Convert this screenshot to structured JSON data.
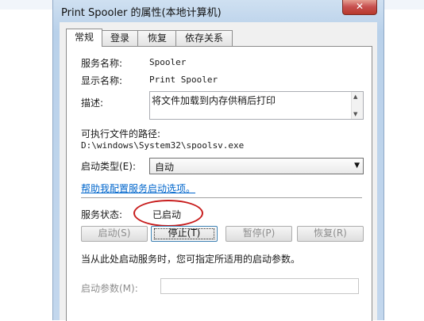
{
  "window": {
    "title": "Print Spooler 的属性(本地计算机)",
    "close_glyph": "✕"
  },
  "tabs": [
    {
      "label": "常规"
    },
    {
      "label": "登录"
    },
    {
      "label": "恢复"
    },
    {
      "label": "依存关系"
    }
  ],
  "general": {
    "service_name_label": "服务名称:",
    "service_name_value": "Spooler",
    "display_name_label": "显示名称:",
    "display_name_value": "Print Spooler",
    "description_label": "描述:",
    "description_value": "将文件加载到内存供稍后打印",
    "exe_path_label": "可执行文件的路径:",
    "exe_path_value": "D:\\windows\\System32\\spoolsv.exe",
    "startup_type_label": "启动类型(E):",
    "startup_type_value": "自动",
    "help_link": "帮助我配置服务启动选项。",
    "status_label": "服务状态:",
    "status_value": "已启动",
    "buttons": {
      "start": "启动(S)",
      "stop": "停止(T)",
      "pause": "暂停(P)",
      "resume": "恢复(R)"
    },
    "hint": "当从此处启动服务时，您可指定所适用的启动参数。",
    "start_params_label": "启动参数(M):",
    "start_params_value": ""
  },
  "colors": {
    "annotation_circle": "#c81e1e",
    "link": "#0066cc"
  }
}
